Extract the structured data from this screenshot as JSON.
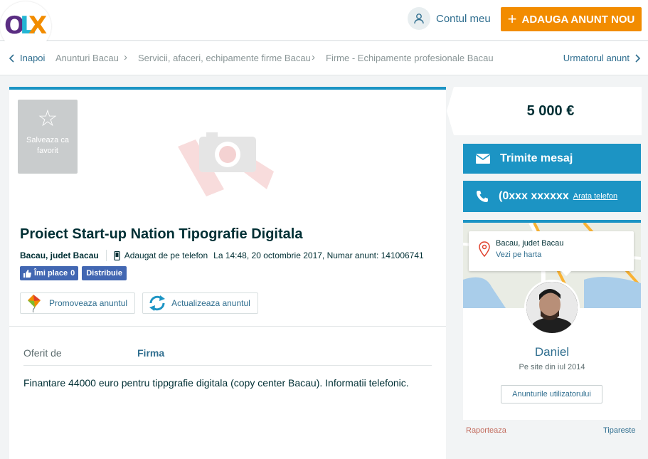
{
  "header": {
    "logo_text": "OLX",
    "account_label": "Contul meu",
    "post_button_label": "ADAUGA ANUNT NOU"
  },
  "breadcrumb": {
    "back_label": "Inapoi",
    "items": [
      "Anunturi Bacau",
      "Servicii, afaceri, echipamente firme Bacau",
      "Firme - Echipamente profesionale Bacau"
    ],
    "next_label": "Urmatorul anunt"
  },
  "ad": {
    "favorite_label": "Salveaza ca favorit",
    "title": "Proiect Start-up Nation Tipografie Digitala",
    "location": "Bacau, judet Bacau",
    "added_via": "Adaugat de pe telefon",
    "date_info": "La 14:48, 20 octombrie 2017, Numar anunt: 141006741",
    "like_label": "Îmi place",
    "like_count": "0",
    "share_label": "Distribuie",
    "promote_label": "Promoveaza anuntul",
    "refresh_label": "Actualizeaza anuntul",
    "details": [
      {
        "key": "Oferit de",
        "value": "Firma"
      }
    ],
    "description": "Finantare 44000 euro pentru tippgrafie digitala (copy center Bacau). Informatii telefonic."
  },
  "sidebar": {
    "price": "5 000 €",
    "message_button": "Trimite mesaj",
    "phone_masked": "(0xxx xxxxxx",
    "show_phone": "Arata telefon",
    "map_city": "Bacau, judet Bacau",
    "map_link": "Vezi pe harta",
    "user_name": "Daniel",
    "user_since": "Pe site din iul 2014",
    "user_ads_button": "Anunturile utilizatorului",
    "report_label": "Raporteaza",
    "print_label": "Tipareste"
  },
  "colors": {
    "accent_blue": "#1c94c4",
    "orange": "#f28c00",
    "link": "#2f6e8f"
  }
}
